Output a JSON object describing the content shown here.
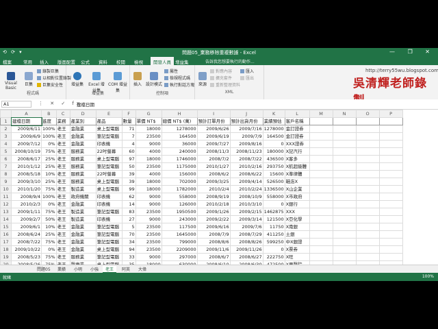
{
  "window": {
    "title": "問題05_業務移除重複數據 - Excel",
    "quick_access": "⟲ ⟳ ▾",
    "controls": "— ❐ ✕"
  },
  "menu_tabs": [
    "檔案",
    "常用",
    "插入",
    "版面配置",
    "公式",
    "資料",
    "校閱",
    "檢視",
    "開發人員",
    "增益集"
  ],
  "active_tab": "開發人員",
  "tell_me": "告訴我您想要執行的動作...",
  "watermark": {
    "url": "http://terry55wu.blogspot.com",
    "text": "吳清輝老師錄製"
  },
  "ribbon": {
    "groups": [
      {
        "label": "程式碼",
        "buttons": [
          "Visual Basic",
          "巨集"
        ],
        "small": [
          "錄製巨集",
          "以相對位置錄製",
          "巨集安全性"
        ]
      },
      {
        "label": "增益集",
        "buttons": [
          "增益集",
          "Excel 增益集",
          "COM 增益集"
        ]
      },
      {
        "label": "控制項",
        "buttons": [
          "插入",
          "設計模式"
        ],
        "small": [
          "屬性",
          "檢視程式碼",
          "執行對話方塊"
        ]
      },
      {
        "label": "XML",
        "buttons": [
          "來源"
        ],
        "small": [
          "對應內容",
          "擴充套件",
          "重新整理資料",
          "匯入",
          "匯出"
        ]
      }
    ]
  },
  "formula_bar": {
    "name_box": "A1",
    "icons": "⋮ ✕ ✓ fx",
    "value": "建檔日期"
  },
  "grid": {
    "columns": [
      "A",
      "B",
      "C",
      "D",
      "E",
      "F",
      "G",
      "H",
      "I",
      "J",
      "K",
      "L",
      "M",
      "N",
      "O",
      "P"
    ],
    "header": [
      "建檔日期",
      "進度",
      "業務",
      "產業別",
      "產品",
      "數量",
      "單價 NT$",
      "總價 NT$ (萬)",
      "預計訂單月份",
      "預計出貨月份",
      "業績預估",
      "客戶名稱"
    ],
    "rows": [
      [
        "2009/6/11",
        "100%",
        "老王",
        "金融業",
        "桌上型電腦",
        "71",
        "18000",
        "1278000",
        "2009/6/26",
        "2009/7/16",
        "1278000",
        "金訂證券"
      ],
      [
        "2009/6/9",
        "100%",
        "老王",
        "金融業",
        "筆記型電腦",
        "7",
        "23500",
        "164500",
        "2009/6/19",
        "2009/7/9",
        "164500",
        "金訂證券"
      ],
      [
        "2009/7/12",
        "0%",
        "老王",
        "金融業",
        "印表機",
        "4",
        "9000",
        "36000",
        "2009/7/27",
        "2009/8/16",
        "0",
        "XXX證券"
      ],
      [
        "2008/10/19",
        "75%",
        "老王",
        "服務業",
        "22吋螢幕",
        "60",
        "4000",
        "240000",
        "2008/11/3",
        "2008/11/23",
        "180000",
        "X記汽行"
      ],
      [
        "2008/6/17",
        "25%",
        "老王",
        "服務業",
        "桌上型電腦",
        "97",
        "18000",
        "1746000",
        "2008/7/2",
        "2008/7/22",
        "436500",
        "X客多"
      ],
      [
        "2010/1/12",
        "25%",
        "老王",
        "服務業",
        "筆記型電腦",
        "50",
        "23500",
        "1175000",
        "2010/1/27",
        "2010/2/16",
        "293750",
        "X航超級體"
      ],
      [
        "2008/5/18",
        "10%",
        "老王",
        "服務業",
        "22吋螢幕",
        "39",
        "4000",
        "156000",
        "2008/6/2",
        "2008/6/22",
        "15600",
        "X準律體"
      ],
      [
        "2009/3/10",
        "25%",
        "老王",
        "服務業",
        "桌上型電腦",
        "39",
        "18000",
        "702000",
        "2009/3/25",
        "2009/4/14",
        "526500",
        "鞋店X"
      ],
      [
        "2010/1/20",
        "75%",
        "老王",
        "製造業",
        "桌上型電腦",
        "99",
        "18000",
        "1782000",
        "2010/2/4",
        "2010/2/24",
        "1336500",
        "X山企業"
      ],
      [
        "2008/9/4",
        "100%",
        "老王",
        "政府機關",
        "印表機",
        "62",
        "9000",
        "558000",
        "2008/9/19",
        "2008/10/9",
        "558000",
        "X市政府"
      ],
      [
        "2010/2/3",
        "0%",
        "老王",
        "金融業",
        "印表機",
        "14",
        "9000",
        "126000",
        "2010/2/18",
        "2010/3/10",
        "0",
        "X銀行"
      ],
      [
        "2009/1/11",
        "75%",
        "老王",
        "製造業",
        "筆記型電腦",
        "83",
        "23500",
        "1950500",
        "2009/1/26",
        "2009/2/15",
        "1462875",
        "XXX"
      ],
      [
        "2009/2/7",
        "50%",
        "老王",
        "製造業",
        "印表機",
        "27",
        "9000",
        "243000",
        "2009/2/22",
        "2009/3/14",
        "121500",
        "X亞化學"
      ],
      [
        "2009/6/1",
        "10%",
        "老王",
        "金融業",
        "筆記型電腦",
        "5",
        "23500",
        "117500",
        "2009/6/16",
        "2009/7/6",
        "11750",
        "X南銀"
      ],
      [
        "2008/6/24",
        "25%",
        "老王",
        "金融業",
        "筆記型電腦",
        "70",
        "23500",
        "1645000",
        "2008/7/9",
        "2008/7/29",
        "411250",
        "土銀"
      ],
      [
        "2008/7/22",
        "75%",
        "老王",
        "金融業",
        "筆記型電腦",
        "34",
        "23500",
        "799000",
        "2008/8/6",
        "2008/8/26",
        "599250",
        "中X銀證"
      ],
      [
        "2009/10/22",
        "0%",
        "老王",
        "金融業",
        "桌上型電腦",
        "94",
        "23500",
        "2209000",
        "2009/11/6",
        "2009/11/26",
        "0",
        "X票券"
      ],
      [
        "2008/5/23",
        "75%",
        "老王",
        "服務業",
        "筆記型電腦",
        "33",
        "9000",
        "297000",
        "2008/6/7",
        "2008/6/27",
        "222750",
        "X旺"
      ],
      [
        "2008/5/26",
        "75%",
        "老王",
        "醫療業",
        "桌上型電腦",
        "35",
        "18000",
        "630000",
        "2008/6/10",
        "2008/6/30",
        "472500",
        "X里醫院"
      ],
      [
        "2009/11/28",
        "75%",
        "老王",
        "醫療業",
        "筆記型電腦",
        "69",
        "23500",
        "1621500",
        "2009/12/13",
        "2010/1/2",
        "1216125",
        "X航銀行"
      ]
    ]
  },
  "sheet_tabs": [
    "問題05",
    "業績",
    "小明",
    "小強",
    "老王",
    "阿英",
    "大偉"
  ],
  "active_sheet": "老王",
  "status": {
    "left": "就緒",
    "right": "100%"
  }
}
